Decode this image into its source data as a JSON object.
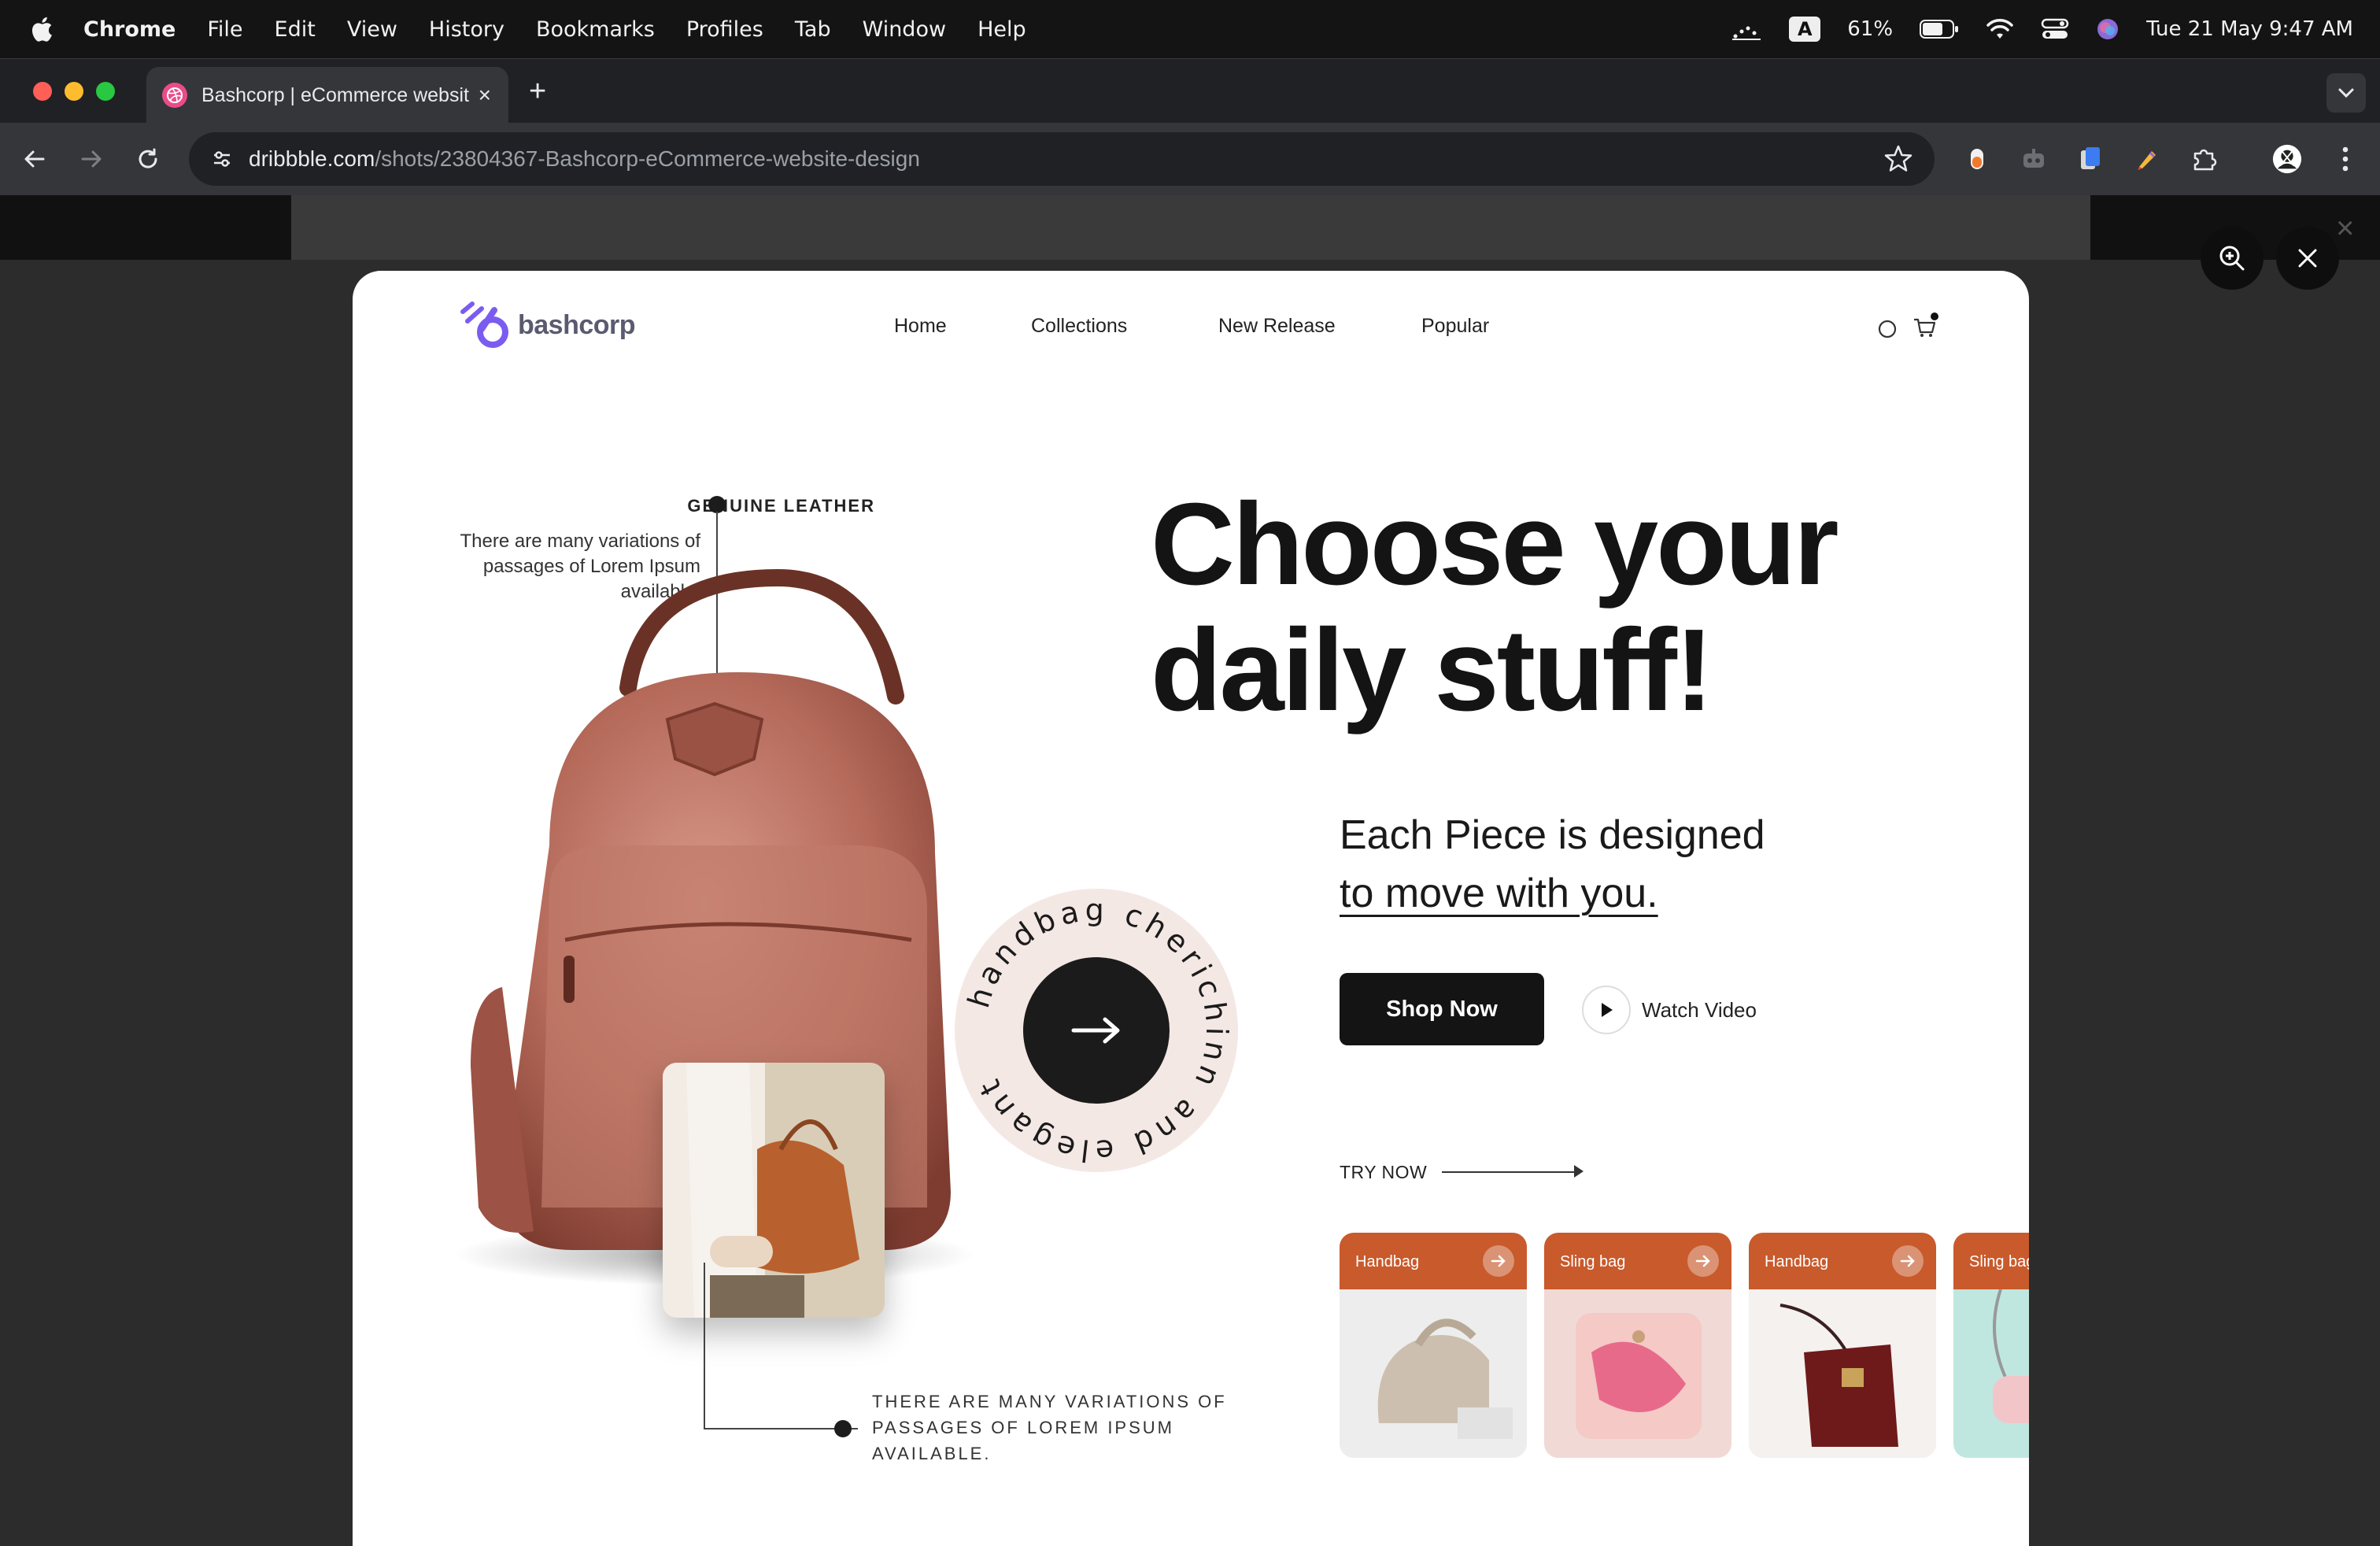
{
  "menubar": {
    "app": "Chrome",
    "items": [
      "File",
      "Edit",
      "View",
      "History",
      "Bookmarks",
      "Profiles",
      "Tab",
      "Window",
      "Help"
    ],
    "battery": "61%",
    "input_badge": "A",
    "datetime": "Tue 21 May  9:47 AM"
  },
  "browser": {
    "tab_title": "Bashcorp | eCommerce website design",
    "tab_close": "×",
    "new_tab": "+",
    "url_host": "dribbble.com",
    "url_path": "/shots/23804367-Bashcorp-eCommerce-website-design"
  },
  "overlay": {
    "close_small": "×"
  },
  "shot": {
    "logo": "bashcorp",
    "nav": [
      "Home",
      "Collections",
      "New Release",
      "Popular"
    ],
    "genuine_title": "GENUINE LEATHER",
    "genuine_desc": "There are many variations of passages of Lorem Ipsum available.",
    "circle_text": "handbag cherichinn and elegant",
    "bottom_text": "THERE ARE MANY VARIATIONS OF PASSAGES OF LOREM IPSUM AVAILABLE.",
    "headline_1": "Choose your",
    "headline_2": "daily stuff!",
    "sub_1": "Each Piece is designed",
    "sub_2": "to move with you.",
    "shop_now": "Shop Now",
    "watch_video": "Watch Video",
    "try_now": "TRY NOW",
    "products": [
      "Handbag",
      "Sling bag",
      "Handbag",
      "Sling bag"
    ]
  },
  "colors": {
    "accent_orange": "#c85a2c",
    "logo_purple": "#7b5cf0",
    "leather": "#a85a4a"
  }
}
